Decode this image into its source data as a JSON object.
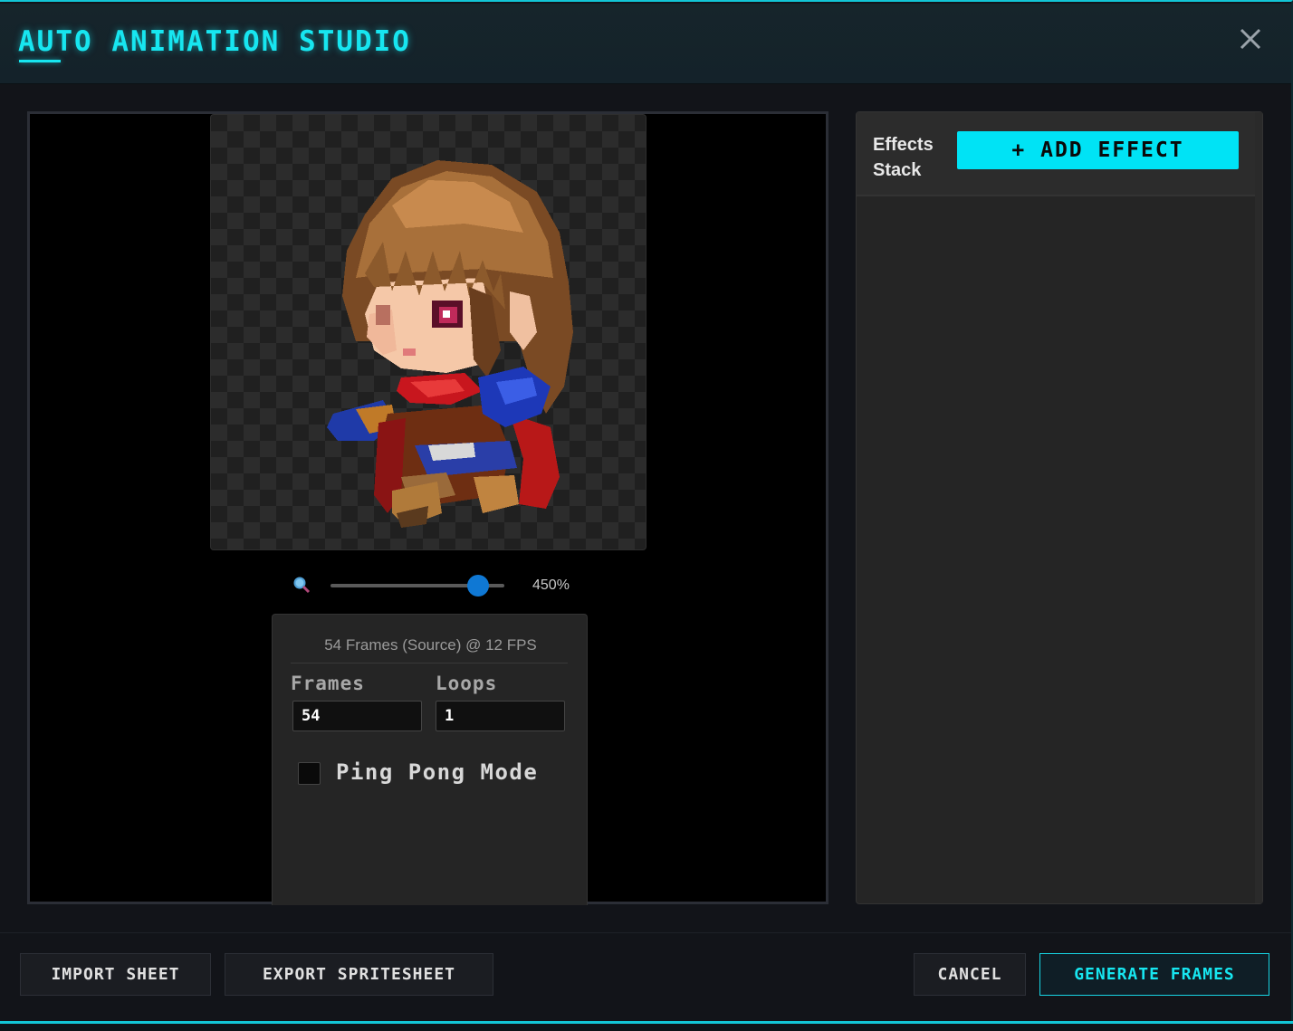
{
  "window": {
    "title": "AUTO ANIMATION STUDIO",
    "close_icon": "close-icon",
    "accent_color": "#17e6f0"
  },
  "preview": {
    "sprite_description_icon": "sprite-image",
    "zoom_icon": "magnifier-icon",
    "zoom_value": "450%",
    "zoom_slider_fraction": 0.85
  },
  "animation": {
    "summary": "54 Frames (Source) @ 12 FPS",
    "frames_label": "Frames",
    "frames_value": "54",
    "loops_label": "Loops",
    "loops_value": "1",
    "ping_pong_label": "Ping Pong Mode",
    "ping_pong_checked": false
  },
  "effects": {
    "title": "Effects Stack",
    "add_button": "+ ADD EFFECT",
    "items": []
  },
  "footer": {
    "import_label": "IMPORT SHEET",
    "export_label": "EXPORT SPRITESHEET",
    "cancel_label": "CANCEL",
    "generate_label": "GENERATE FRAMES"
  }
}
